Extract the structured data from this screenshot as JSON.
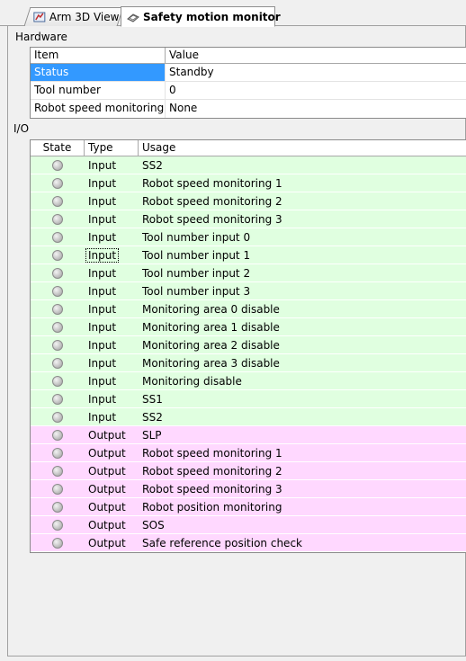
{
  "tabs": [
    {
      "label": "Arm 3D View"
    },
    {
      "label": "Safety motion monitor"
    }
  ],
  "hardware": {
    "section_label": "Hardware",
    "headers": {
      "item": "Item",
      "value": "Value"
    },
    "rows": [
      {
        "item": "Status",
        "value": "Standby"
      },
      {
        "item": "Tool number",
        "value": "0"
      },
      {
        "item": "Robot speed monitoring",
        "value": "None"
      }
    ]
  },
  "io": {
    "section_label": "I/O",
    "headers": {
      "state": "State",
      "type": "Type",
      "usage": "Usage"
    },
    "rows": [
      {
        "type": "Input",
        "usage": "SS2"
      },
      {
        "type": "Input",
        "usage": "Robot speed monitoring 1"
      },
      {
        "type": "Input",
        "usage": "Robot speed monitoring 2"
      },
      {
        "type": "Input",
        "usage": "Robot speed monitoring 3"
      },
      {
        "type": "Input",
        "usage": "Tool number input 0"
      },
      {
        "type": "Input",
        "usage": "Tool number input 1"
      },
      {
        "type": "Input",
        "usage": "Tool number input 2"
      },
      {
        "type": "Input",
        "usage": "Tool number input 3"
      },
      {
        "type": "Input",
        "usage": "Monitoring area 0 disable"
      },
      {
        "type": "Input",
        "usage": "Monitoring area 1 disable"
      },
      {
        "type": "Input",
        "usage": "Monitoring area 2 disable"
      },
      {
        "type": "Input",
        "usage": "Monitoring area 3 disable"
      },
      {
        "type": "Input",
        "usage": "Monitoring disable"
      },
      {
        "type": "Input",
        "usage": "SS1"
      },
      {
        "type": "Input",
        "usage": "SS2"
      },
      {
        "type": "Output",
        "usage": "SLP"
      },
      {
        "type": "Output",
        "usage": "Robot speed monitoring 1"
      },
      {
        "type": "Output",
        "usage": "Robot speed monitoring 2"
      },
      {
        "type": "Output",
        "usage": "Robot speed monitoring 3"
      },
      {
        "type": "Output",
        "usage": "Robot position monitoring"
      },
      {
        "type": "Output",
        "usage": "SOS"
      },
      {
        "type": "Output",
        "usage": "Safe reference position check"
      }
    ]
  },
  "colors": {
    "input_row": "#e0ffe0",
    "output_row": "#ffd8ff",
    "selection": "#3399ff"
  }
}
